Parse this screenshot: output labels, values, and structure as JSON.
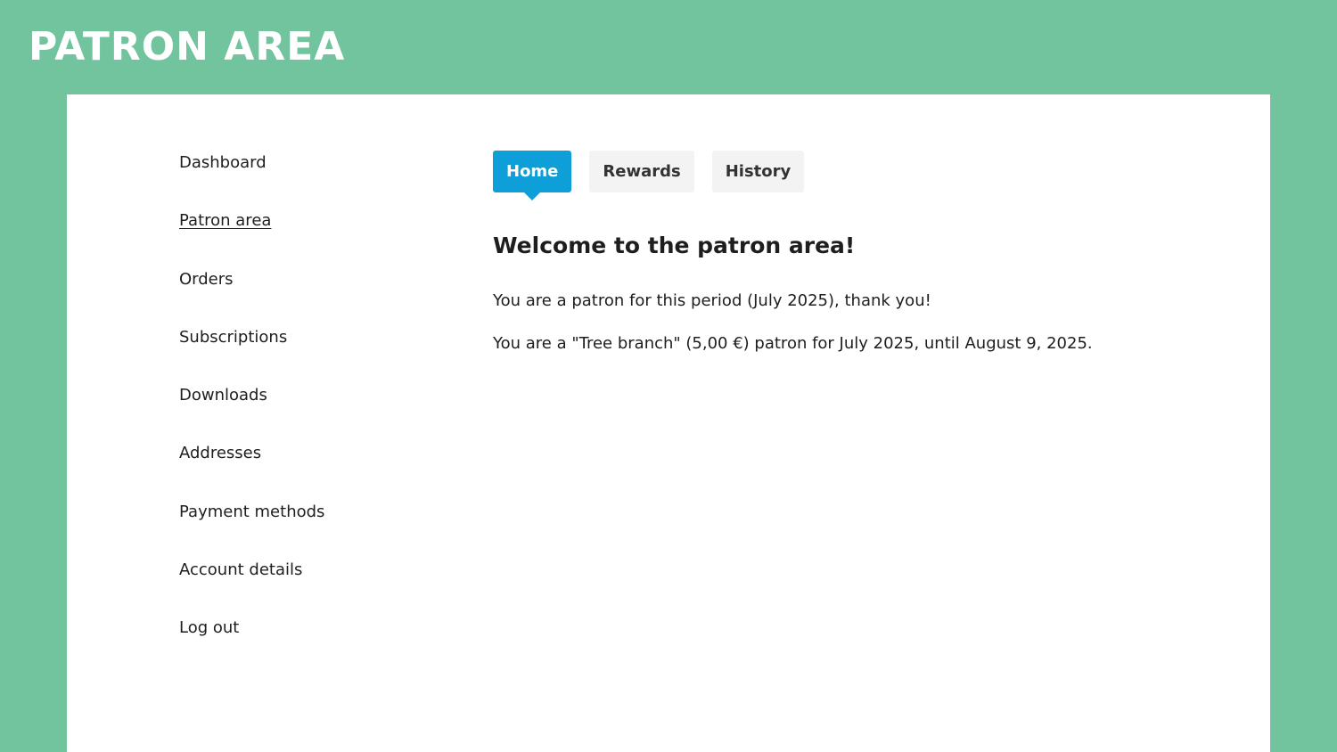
{
  "header": {
    "title": "PATRON AREA"
  },
  "sidebar": {
    "items": [
      {
        "label": "Dashboard"
      },
      {
        "label": "Patron area",
        "current": true
      },
      {
        "label": "Orders"
      },
      {
        "label": "Subscriptions"
      },
      {
        "label": "Downloads"
      },
      {
        "label": "Addresses"
      },
      {
        "label": "Payment methods"
      },
      {
        "label": "Account details"
      },
      {
        "label": "Log out"
      }
    ]
  },
  "main": {
    "tabs": [
      {
        "label": "Home",
        "active": true
      },
      {
        "label": "Rewards"
      },
      {
        "label": "History"
      }
    ],
    "heading": "Welcome to the patron area!",
    "paragraphs": [
      "You are a patron for this period (July 2025), thank you!",
      "You are a \"Tree branch\" (5,00 €) patron for July 2025, until August 9, 2025."
    ]
  },
  "colors": {
    "background": "#72c49e",
    "card": "#ffffff",
    "accent": "#0e9fd8",
    "tab_inactive": "#f3f3f3",
    "text": "#1e1e1e"
  }
}
